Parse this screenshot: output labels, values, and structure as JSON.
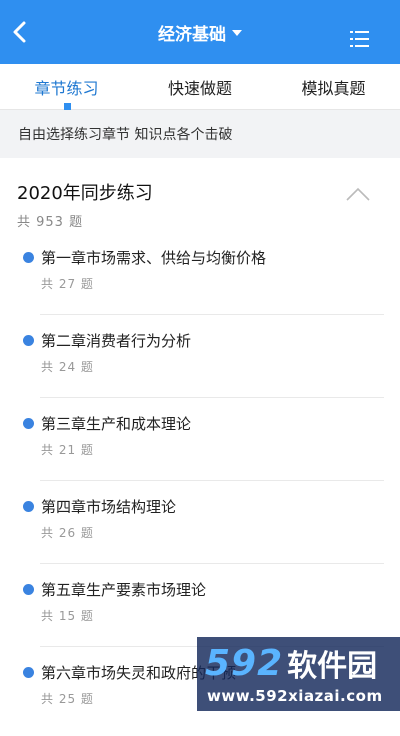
{
  "header": {
    "title": "经济基础",
    "background": "#2f8ff0"
  },
  "tabs": [
    {
      "label": "章节练习",
      "active": true
    },
    {
      "label": "快速做题",
      "active": false
    },
    {
      "label": "模拟真题",
      "active": false
    }
  ],
  "hint": "自由选择练习章节 知识点各个击破",
  "section": {
    "title": "2020年同步练习",
    "count": "共 953 题",
    "expanded": true
  },
  "chapters": [
    {
      "name": "第一章市场需求、供给与均衡价格",
      "count": "共 27 题"
    },
    {
      "name": "第二章消费者行为分析",
      "count": "共 24 题"
    },
    {
      "name": "第三章生产和成本理论",
      "count": "共 21 题"
    },
    {
      "name": "第四章市场结构理论",
      "count": "共 26 题"
    },
    {
      "name": "第五章生产要素市场理论",
      "count": "共 15 题"
    },
    {
      "name": "第六章市场失灵和政府的干预",
      "count": "共 25 题"
    }
  ],
  "watermark": {
    "logo_number": "592",
    "logo_text": "软件园",
    "url": "www.592xiazai.com"
  },
  "icons": {
    "back": "chevron-left-icon",
    "menu": "list-icon",
    "collapse": "chevron-up-icon",
    "dropdown": "caret-down-icon"
  },
  "colors": {
    "accent": "#2f8ff0",
    "active_tab": "#1f78d1",
    "bullet": "#3a83e0"
  }
}
